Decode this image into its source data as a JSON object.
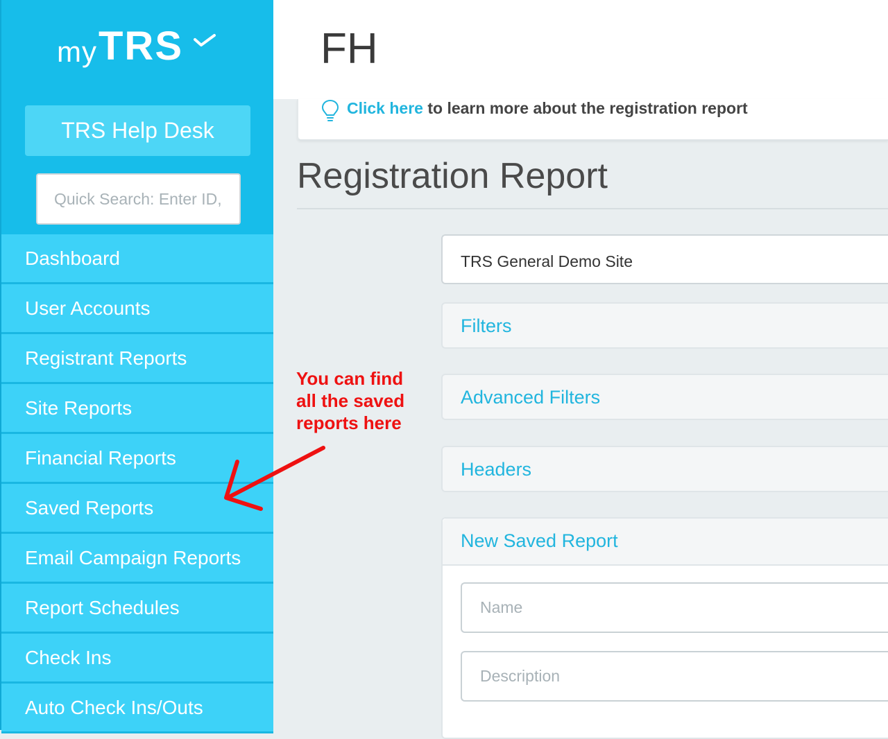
{
  "sidebar": {
    "logo": {
      "my": "my",
      "brand": "TRS"
    },
    "help_desk_label": "TRS Help Desk",
    "quick_search_placeholder": "Quick Search: Enter ID, first or last name",
    "items": [
      {
        "label": "Dashboard"
      },
      {
        "label": "User Accounts"
      },
      {
        "label": "Registrant Reports"
      },
      {
        "label": "Site Reports"
      },
      {
        "label": "Financial Reports"
      },
      {
        "label": "Saved Reports"
      },
      {
        "label": "Email Campaign Reports"
      },
      {
        "label": "Report Schedules"
      },
      {
        "label": "Check Ins"
      },
      {
        "label": "Auto Check Ins/Outs"
      }
    ]
  },
  "header": {
    "title": "FH"
  },
  "info": {
    "link_text": "Click here",
    "rest_text": " to learn more about the registration report"
  },
  "main": {
    "title": "Registration Report",
    "site_value": "TRS General Demo Site",
    "sections": {
      "filters": "Filters",
      "advanced_filters": "Advanced Filters",
      "headers": "Headers",
      "new_saved_report": "New Saved Report"
    },
    "name_placeholder": "Name",
    "description_placeholder": "Description"
  },
  "annotation": {
    "lines": [
      "You can find",
      "all the saved",
      "reports here"
    ]
  },
  "colors": {
    "sidebar": "#17bdea",
    "nav_item": "#3dd2f8",
    "link": "#21b5de",
    "annotation": "#ee1111"
  }
}
